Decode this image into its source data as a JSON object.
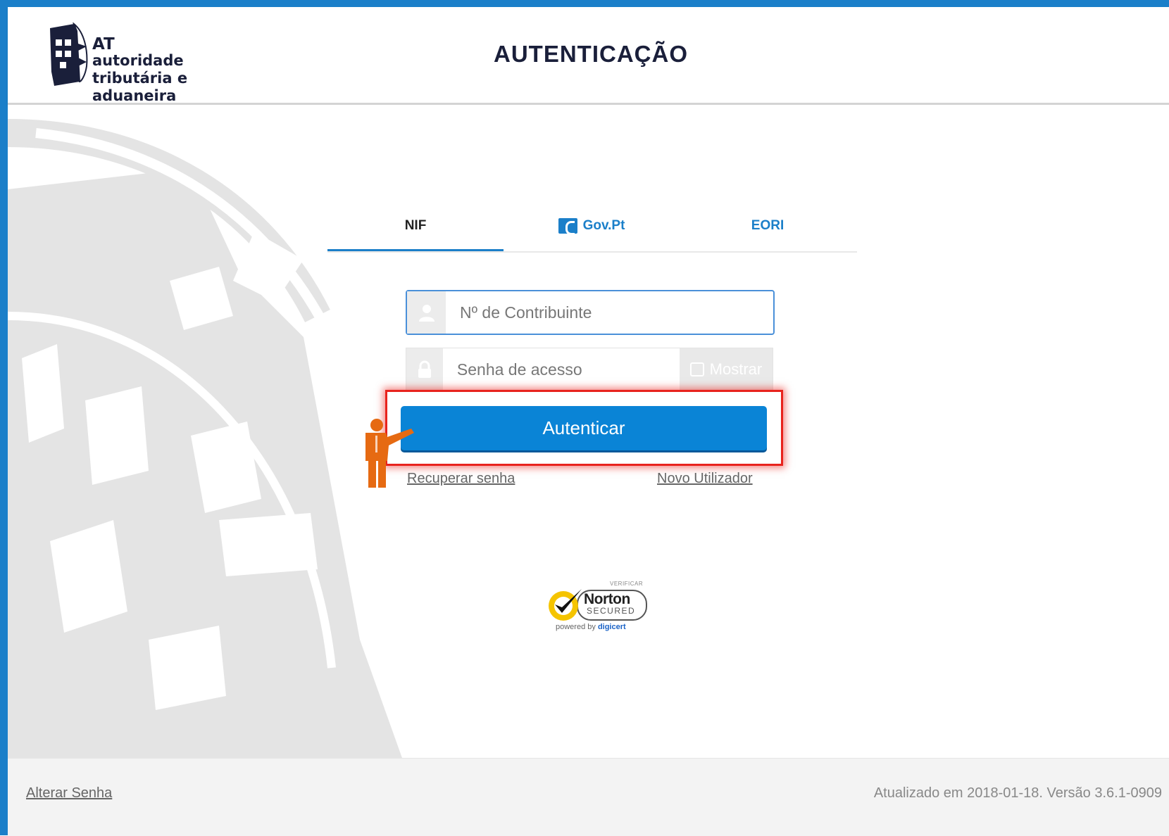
{
  "brand": {
    "acronym": "AT",
    "line1": "autoridade",
    "line2": "tributária e aduaneira",
    "color_primary": "#1b7fc9",
    "color_text": "#1a1f3a"
  },
  "page": {
    "title": "AUTENTICAÇÃO"
  },
  "tabs": [
    {
      "label": "NIF",
      "active": true
    },
    {
      "label": "Gov.Pt",
      "active": false,
      "icon": "gov-pt-icon"
    },
    {
      "label": "EORI",
      "active": false
    }
  ],
  "login_form": {
    "nif_placeholder": "Nº de Contribuinte",
    "nif_value": "",
    "nif_icon": "user-icon",
    "password_placeholder": "Senha de acesso",
    "password_value": "",
    "password_icon": "lock-icon",
    "show_password_label": "Mostrar",
    "show_password_checked": false,
    "submit_label": "Autenticar",
    "submit_color": "#0a84d6"
  },
  "links": {
    "recover_password": "Recuperar senha",
    "new_user": "Novo Utilizador"
  },
  "badge": {
    "verify": "VERIFICAR",
    "name": "Norton",
    "secured": "SECURED",
    "powered_by": "powered by",
    "provider": "digicert"
  },
  "footer": {
    "change_password": "Alterar Senha",
    "version_text": "Atualizado em 2018-01-18. Versão 3.6.1-0909"
  },
  "annotation": {
    "highlight_color": "#e8231d",
    "presenter_color": "#e66a12"
  }
}
